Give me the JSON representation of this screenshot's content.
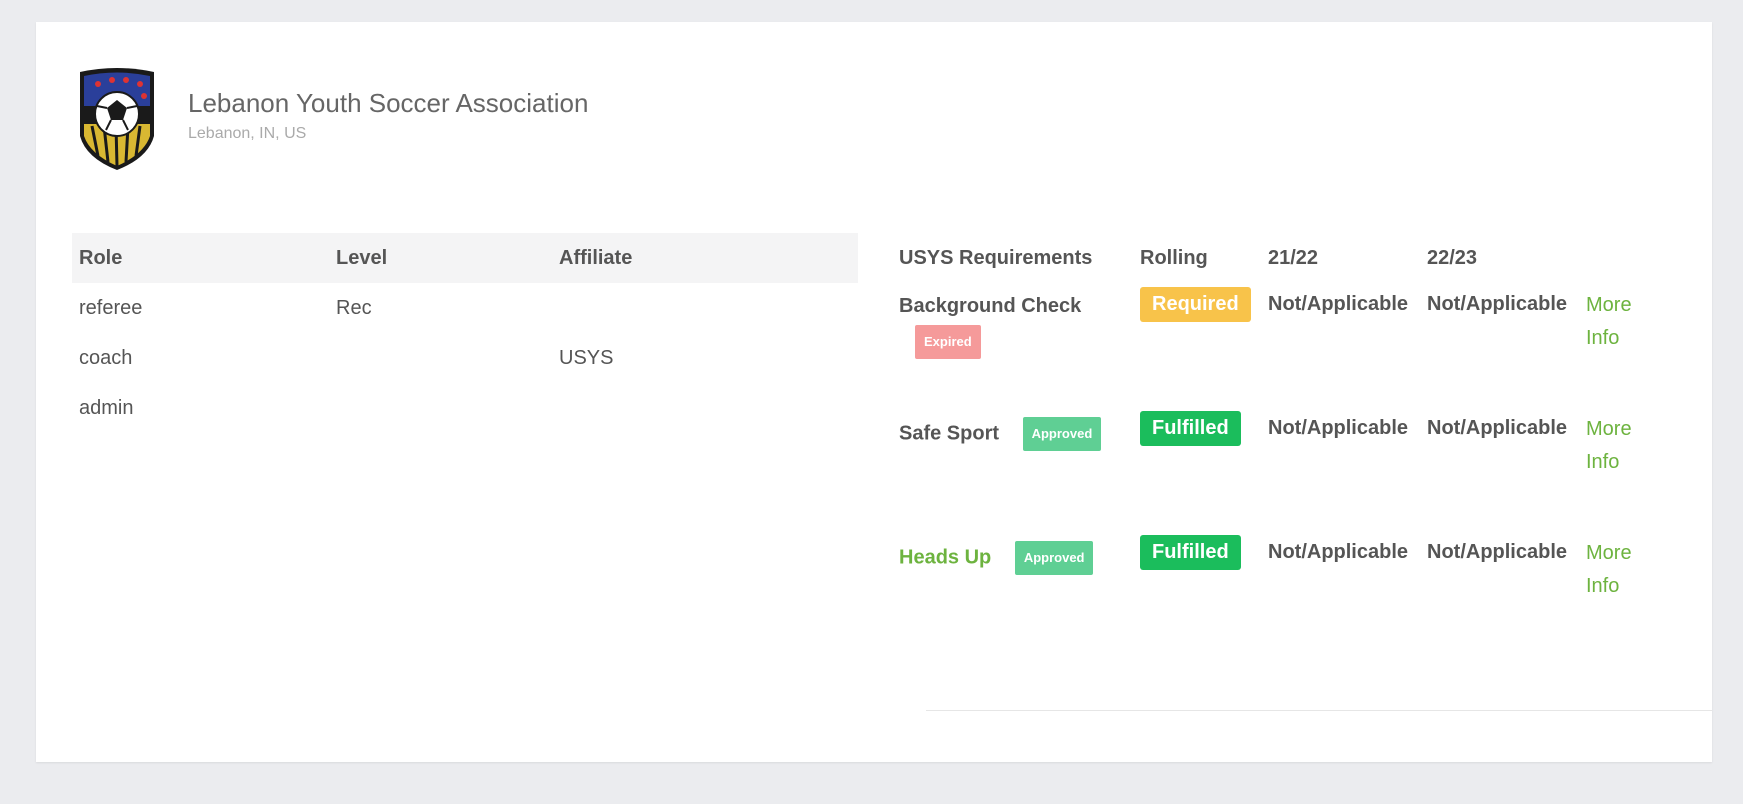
{
  "organization": {
    "name": "Lebanon Youth Soccer Association",
    "location": "Lebanon, IN, US"
  },
  "roles_table": {
    "headers": {
      "role": "Role",
      "level": "Level",
      "affiliate": "Affiliate"
    },
    "rows": [
      {
        "role": "referee",
        "level": "Rec",
        "affiliate": ""
      },
      {
        "role": "coach",
        "level": "",
        "affiliate": "USYS"
      },
      {
        "role": "admin",
        "level": "",
        "affiliate": ""
      }
    ]
  },
  "requirements_table": {
    "headers": {
      "name": "USYS Requirements",
      "rolling": "Rolling",
      "y1": "21/22",
      "y2": "22/23"
    },
    "rows": [
      {
        "name": "Background Check",
        "tag": "Expired",
        "rolling": "Required",
        "y1": "Not/Applicable",
        "y2": "Not/Applicable",
        "more_line1": "More",
        "more_line2": "Info"
      },
      {
        "name": "Safe Sport",
        "tag": "Approved",
        "rolling": "Fulfilled",
        "y1": "Not/Applicable",
        "y2": "Not/Applicable",
        "more_line1": "More",
        "more_line2": "Info"
      },
      {
        "name": "Heads Up",
        "tag": "Approved",
        "rolling": "Fulfilled",
        "y1": "Not/Applicable",
        "y2": "Not/Applicable",
        "more_line1": "More",
        "more_line2": "Info"
      }
    ]
  },
  "colors": {
    "required": "#f8c34a",
    "fulfilled": "#1bbd5c",
    "expired": "#f59a9a",
    "approved": "#5fcf94",
    "link": "#6db33f"
  },
  "icons": {
    "logo": "club-crest-logo"
  }
}
